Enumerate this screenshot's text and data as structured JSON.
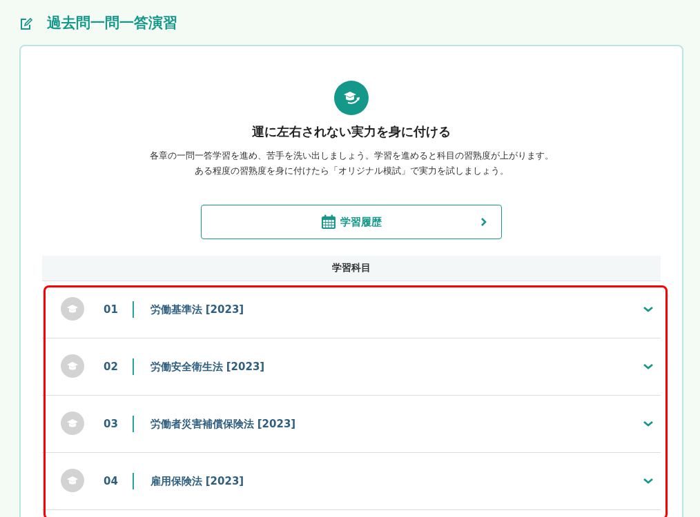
{
  "page_title": "過去問一問一答演習",
  "intro": {
    "heading": "運に左右されない実力を身に付ける",
    "lines": [
      "各章の一問一答学習を進め、苦手を洗い出しましょう。学習を進めると科目の習熟度が上がります。",
      "ある程度の習熟度を身に付けたら「オリジナル模試」で実力を試しましょう。"
    ]
  },
  "history_button": {
    "label": "学習履歴"
  },
  "subjects": {
    "header": "学習科目",
    "rows": [
      {
        "number": "01",
        "name": "労働基準法 [2023]",
        "expanded": false
      },
      {
        "number": "02",
        "name": "労働安全衛生法 [2023]",
        "expanded": false
      },
      {
        "number": "03",
        "name": "労働者災害補償保険法 [2023]",
        "expanded": false
      },
      {
        "number": "04",
        "name": "雇用保険法 [2023]",
        "expanded": false
      }
    ]
  }
}
